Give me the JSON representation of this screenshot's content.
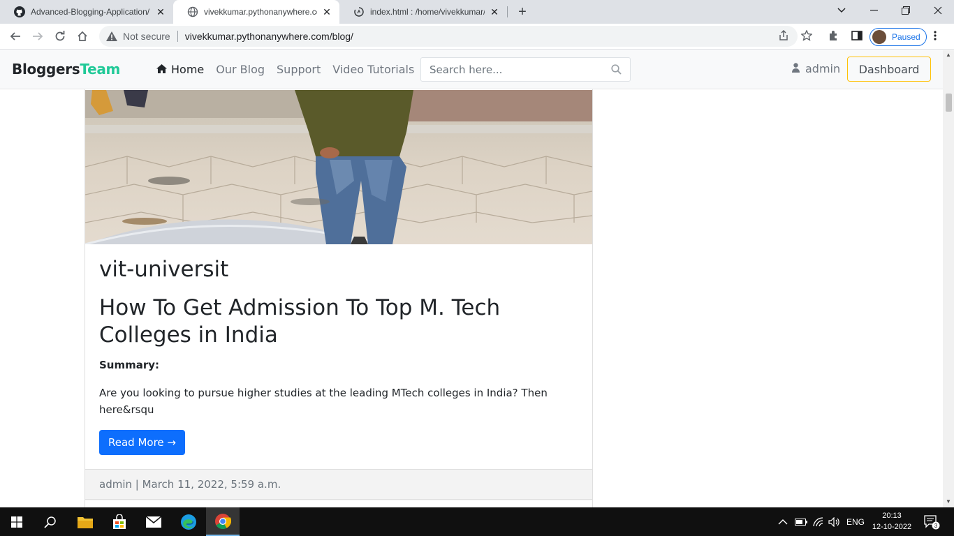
{
  "browser": {
    "tabs": [
      {
        "title": "Advanced-Blogging-Application/",
        "icon": "github-icon"
      },
      {
        "title": "vivekkumar.pythonanywhere.com",
        "icon": "globe-icon"
      },
      {
        "title": "index.html : /home/vivekkumar/B",
        "icon": "loading-icon"
      }
    ],
    "security_label": "Not secure",
    "url": "vivekkumar.pythonanywhere.com/blog/",
    "profile_status": "Paused"
  },
  "site": {
    "brand_main": "Bloggers",
    "brand_accent": "Team",
    "nav": [
      {
        "label": "Home"
      },
      {
        "label": "Our Blog"
      },
      {
        "label": "Support"
      },
      {
        "label": "Video Tutorials"
      }
    ],
    "search_placeholder": "Search here...",
    "username": "admin",
    "dashboard_label": "Dashboard",
    "accent_color": "#20c997"
  },
  "post": {
    "category": "vit-universit",
    "title": "How To Get Admission To Top M. Tech Colleges in India",
    "summary_label": "Summary:",
    "excerpt": "Are you looking to pursue higher studies at the leading MTech colleges in India? Then here&rsqu",
    "read_more_label": "Read More →",
    "footer": "admin | March 11, 2022, 5:59 a.m."
  },
  "taskbar": {
    "language": "ENG",
    "time": "20:13",
    "date": "12-10-2022",
    "notifications": "3"
  }
}
